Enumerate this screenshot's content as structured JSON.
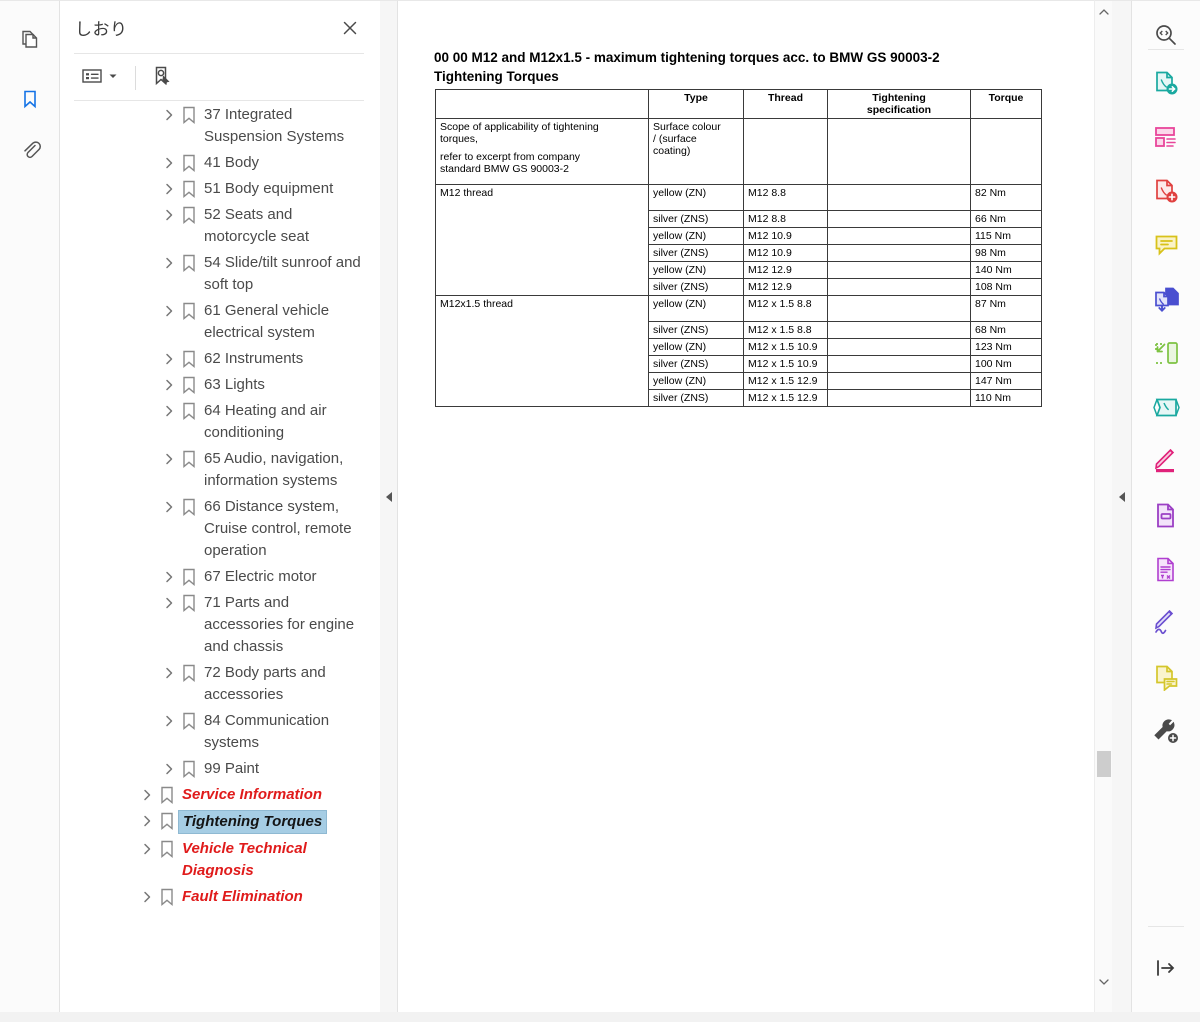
{
  "app": {
    "left_rail": [
      {
        "name": "page-thumbnails-icon",
        "label": "Page Thumbnails",
        "active": false
      },
      {
        "name": "bookmarks-icon",
        "label": "Bookmarks",
        "active": true
      },
      {
        "name": "attachments-icon",
        "label": "Attachments",
        "active": false
      }
    ]
  },
  "bookmarks_panel": {
    "title": "しおり",
    "close_label": "×",
    "toolbar": [
      {
        "name": "bookmark-options-icon",
        "label": "Bookmark Options"
      },
      {
        "name": "find-current-bookmark-icon",
        "label": "Find Current Bookmark"
      }
    ],
    "items": [
      {
        "label": "37 Integrated Suspension Systems",
        "level": 2,
        "style": "normal",
        "selected": false
      },
      {
        "label": "41 Body",
        "level": 2,
        "style": "normal",
        "selected": false
      },
      {
        "label": "51 Body equipment",
        "level": 2,
        "style": "normal",
        "selected": false
      },
      {
        "label": "52 Seats and motorcycle seat",
        "level": 2,
        "style": "normal",
        "selected": false
      },
      {
        "label": "54 Slide/tilt sunroof and soft top",
        "level": 2,
        "style": "normal",
        "selected": false
      },
      {
        "label": "61 General vehicle electrical system",
        "level": 2,
        "style": "normal",
        "selected": false
      },
      {
        "label": "62 Instruments",
        "level": 2,
        "style": "normal",
        "selected": false
      },
      {
        "label": "63 Lights",
        "level": 2,
        "style": "normal",
        "selected": false
      },
      {
        "label": "64 Heating and air conditioning",
        "level": 2,
        "style": "normal",
        "selected": false
      },
      {
        "label": "65 Audio, navigation, information systems",
        "level": 2,
        "style": "normal",
        "selected": false
      },
      {
        "label": "66 Distance system, Cruise control, remote operation",
        "level": 2,
        "style": "normal",
        "selected": false
      },
      {
        "label": "67 Electric motor",
        "level": 2,
        "style": "normal",
        "selected": false
      },
      {
        "label": "71 Parts and accessories for engine and chassis",
        "level": 2,
        "style": "normal",
        "selected": false
      },
      {
        "label": "72 Body parts and accessories",
        "level": 2,
        "style": "normal",
        "selected": false
      },
      {
        "label": "84 Communication systems",
        "level": 2,
        "style": "normal",
        "selected": false
      },
      {
        "label": "99 Paint",
        "level": 2,
        "style": "normal",
        "selected": false
      },
      {
        "label": "Service Information",
        "level": 1,
        "style": "red",
        "selected": false
      },
      {
        "label": "Tightening Torques",
        "level": 1,
        "style": "red",
        "selected": true
      },
      {
        "label": "Vehicle Technical Diagnosis",
        "level": 1,
        "style": "red",
        "selected": false
      },
      {
        "label": "Fault Elimination",
        "level": 1,
        "style": "red",
        "selected": false
      }
    ]
  },
  "document": {
    "title_line1": "00 00 M12 and M12x1.5 - maximum tightening torques acc. to BMW GS 90003-2",
    "title_line2": "Tightening Torques",
    "table": {
      "headers": [
        "",
        "Type",
        "Thread",
        "Tightening specification",
        "Torque"
      ],
      "header_tightening_line1": "Tightening",
      "header_tightening_line2": "specification",
      "scope_cell_line1": "Scope of applicability of tightening",
      "scope_cell_line2": "torques,",
      "scope_cell_line3": "refer to excerpt from company",
      "scope_cell_line4": "standard BMW GS 90003-2",
      "surface_cell_line1": "Surface colour",
      "surface_cell_line2": "/ (surface",
      "surface_cell_line3": "coating)",
      "group1_label": "M12 thread",
      "group2_label": "M12x1.5 thread",
      "rows": [
        {
          "group": "M12 thread",
          "type": "yellow (ZN)",
          "thread": "M12 8.8",
          "spec": "",
          "torque": "82 Nm"
        },
        {
          "group": "",
          "type": "silver (ZNS)",
          "thread": "M12 8.8",
          "spec": "",
          "torque": "66 Nm"
        },
        {
          "group": "",
          "type": "yellow (ZN)",
          "thread": "M12 10.9",
          "spec": "",
          "torque": "115 Nm"
        },
        {
          "group": "",
          "type": "silver (ZNS)",
          "thread": "M12 10.9",
          "spec": "",
          "torque": "98 Nm"
        },
        {
          "group": "",
          "type": "yellow (ZN)",
          "thread": "M12 12.9",
          "spec": "",
          "torque": "140 Nm"
        },
        {
          "group": "",
          "type": "silver (ZNS)",
          "thread": "M12 12.9",
          "spec": "",
          "torque": "108 Nm"
        },
        {
          "group": "M12x1.5 thread",
          "type": "yellow (ZN)",
          "thread": "M12 x 1.5 8.8",
          "spec": "",
          "torque": "87 Nm"
        },
        {
          "group": "",
          "type": "silver (ZNS)",
          "thread": "M12 x 1.5 8.8",
          "spec": "",
          "torque": "68 Nm"
        },
        {
          "group": "",
          "type": "yellow (ZN)",
          "thread": "M12 x 1.5 10.9",
          "spec": "",
          "torque": "123 Nm"
        },
        {
          "group": "",
          "type": "silver (ZNS)",
          "thread": "M12 x 1.5 10.9",
          "spec": "",
          "torque": "100 Nm"
        },
        {
          "group": "",
          "type": "yellow (ZN)",
          "thread": "M12 x 1.5 12.9",
          "spec": "",
          "torque": "147 Nm"
        },
        {
          "group": "",
          "type": "silver (ZNS)",
          "thread": "M12 x 1.5 12.9",
          "spec": "",
          "torque": "110 Nm"
        }
      ]
    }
  },
  "right_rail": {
    "tools": [
      {
        "name": "search-icon",
        "label": "Search",
        "color": "#4a4a4a"
      },
      {
        "name": "export-pdf-icon",
        "label": "Export PDF",
        "color": "#1aa9a0"
      },
      {
        "name": "organize-pages-icon",
        "label": "Organize Pages",
        "color": "#e8459a"
      },
      {
        "name": "create-pdf-icon",
        "label": "Create PDF",
        "color": "#e0403f"
      },
      {
        "name": "comment-icon",
        "label": "Comment",
        "color": "#d8c21a"
      },
      {
        "name": "combine-files-icon",
        "label": "Combine Files",
        "color": "#4a4fd0"
      },
      {
        "name": "compress-pdf-icon",
        "label": "Compress PDF",
        "color": "#7dc242"
      },
      {
        "name": "protect-pdf-icon",
        "label": "Protect",
        "color": "#1aa9a0"
      },
      {
        "name": "edit-pdf-icon",
        "label": "Edit PDF",
        "color": "#e0227a"
      },
      {
        "name": "fill-and-sign-icon",
        "label": "Fill & Sign",
        "color": "#9b3fc4"
      },
      {
        "name": "prepare-form-icon",
        "label": "Prepare Form",
        "color": "#b03fd0"
      },
      {
        "name": "request-signatures-icon",
        "label": "Request Signatures",
        "color": "#6b4fd0"
      },
      {
        "name": "stamp-icon",
        "label": "Stamp",
        "color": "#d4c62c"
      },
      {
        "name": "more-tools-icon",
        "label": "More Tools",
        "color": "#4a4a4a"
      }
    ],
    "collapse_label": "Collapse pane"
  },
  "scrollbars": {
    "sidebar_up": "▲",
    "sidebar_down": "▼",
    "doc_up": "▲",
    "doc_down": "▼"
  }
}
